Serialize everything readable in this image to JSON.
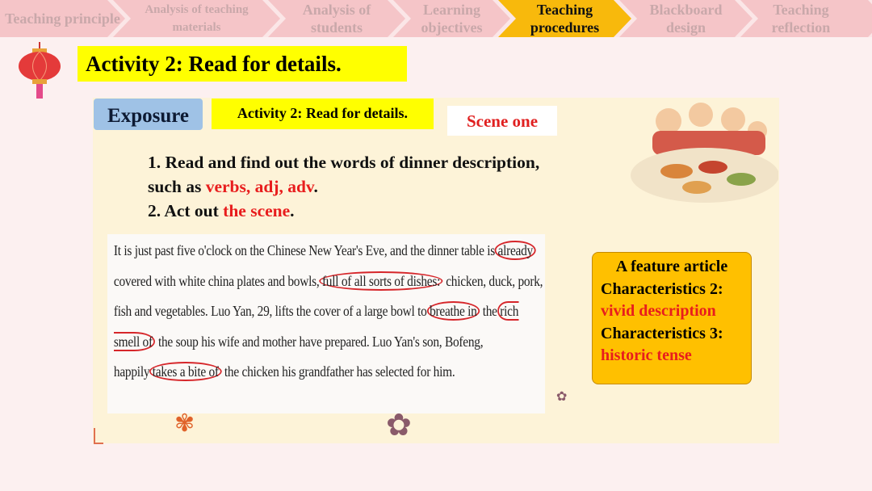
{
  "nav": {
    "steps": [
      {
        "label": "Teaching principle",
        "active": false
      },
      {
        "label": "Analysis of teaching materials",
        "active": false
      },
      {
        "label": "Analysis of students",
        "active": false
      },
      {
        "label": "Learning objectives",
        "active": false
      },
      {
        "label": "Teaching procedures",
        "active": true
      },
      {
        "label": "Blackboard design",
        "active": false
      },
      {
        "label": "Teaching reflection",
        "active": false
      }
    ]
  },
  "title": "Activity 2: Read for details.",
  "exposure": "Exposure",
  "activity_label": "Activity 2: Read for details.",
  "scene": "Scene one",
  "instructions": {
    "l1": "1. Read and  find out the words of dinner description,",
    "l2a": "such as ",
    "l2b": "verbs, adj, adv",
    "l2c": ".",
    "l3a": "2. Act out ",
    "l3b": "the scene",
    "l3c": "."
  },
  "passage": {
    "p1": "It is just past five o'clock on the Chinese New Year's Eve, and the dinner table is",
    "c1": "already",
    "p2": " covered with white china plates and bowls,",
    "c2": "full of all sorts of dishes:",
    "p3": " chicken, duck, pork, fish and vegetables. Luo Yan, 29, lifts the cover of a large bowl to",
    "c3": "breathe in",
    "p4": " the",
    "c4": "rich smell of",
    "p5": " the soup his wife and mother have prepared. Luo Yan's son, Bofeng, happily",
    "c5": "takes a bite of",
    "p6": " the chicken his grandfather has selected for him."
  },
  "feature": {
    "heading": "A feature article",
    "c2": "Characteristics 2:",
    "c2v": "vivid description",
    "c3": "Characteristics 3:",
    "c3v": "historic tense"
  },
  "colors": {
    "active_step": "#f8b90c",
    "highlight": "#ffff00",
    "accent_red": "#e81d1d",
    "scroll": "#ffc000"
  }
}
